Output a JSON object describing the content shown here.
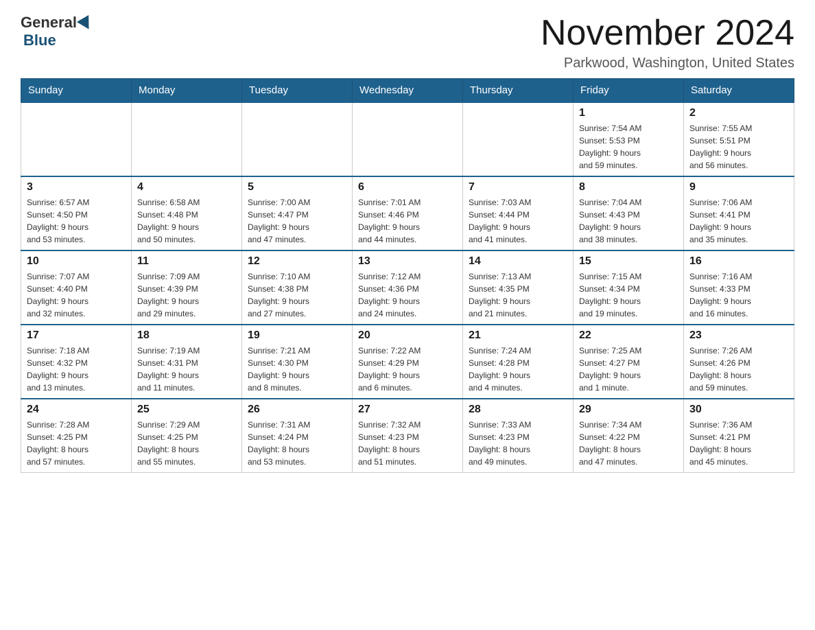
{
  "header": {
    "logo_general": "General",
    "logo_blue": "Blue",
    "month_title": "November 2024",
    "location": "Parkwood, Washington, United States"
  },
  "days_of_week": [
    "Sunday",
    "Monday",
    "Tuesday",
    "Wednesday",
    "Thursday",
    "Friday",
    "Saturday"
  ],
  "weeks": [
    {
      "days": [
        {
          "number": "",
          "info": ""
        },
        {
          "number": "",
          "info": ""
        },
        {
          "number": "",
          "info": ""
        },
        {
          "number": "",
          "info": ""
        },
        {
          "number": "",
          "info": ""
        },
        {
          "number": "1",
          "info": "Sunrise: 7:54 AM\nSunset: 5:53 PM\nDaylight: 9 hours\nand 59 minutes."
        },
        {
          "number": "2",
          "info": "Sunrise: 7:55 AM\nSunset: 5:51 PM\nDaylight: 9 hours\nand 56 minutes."
        }
      ]
    },
    {
      "days": [
        {
          "number": "3",
          "info": "Sunrise: 6:57 AM\nSunset: 4:50 PM\nDaylight: 9 hours\nand 53 minutes."
        },
        {
          "number": "4",
          "info": "Sunrise: 6:58 AM\nSunset: 4:48 PM\nDaylight: 9 hours\nand 50 minutes."
        },
        {
          "number": "5",
          "info": "Sunrise: 7:00 AM\nSunset: 4:47 PM\nDaylight: 9 hours\nand 47 minutes."
        },
        {
          "number": "6",
          "info": "Sunrise: 7:01 AM\nSunset: 4:46 PM\nDaylight: 9 hours\nand 44 minutes."
        },
        {
          "number": "7",
          "info": "Sunrise: 7:03 AM\nSunset: 4:44 PM\nDaylight: 9 hours\nand 41 minutes."
        },
        {
          "number": "8",
          "info": "Sunrise: 7:04 AM\nSunset: 4:43 PM\nDaylight: 9 hours\nand 38 minutes."
        },
        {
          "number": "9",
          "info": "Sunrise: 7:06 AM\nSunset: 4:41 PM\nDaylight: 9 hours\nand 35 minutes."
        }
      ]
    },
    {
      "days": [
        {
          "number": "10",
          "info": "Sunrise: 7:07 AM\nSunset: 4:40 PM\nDaylight: 9 hours\nand 32 minutes."
        },
        {
          "number": "11",
          "info": "Sunrise: 7:09 AM\nSunset: 4:39 PM\nDaylight: 9 hours\nand 29 minutes."
        },
        {
          "number": "12",
          "info": "Sunrise: 7:10 AM\nSunset: 4:38 PM\nDaylight: 9 hours\nand 27 minutes."
        },
        {
          "number": "13",
          "info": "Sunrise: 7:12 AM\nSunset: 4:36 PM\nDaylight: 9 hours\nand 24 minutes."
        },
        {
          "number": "14",
          "info": "Sunrise: 7:13 AM\nSunset: 4:35 PM\nDaylight: 9 hours\nand 21 minutes."
        },
        {
          "number": "15",
          "info": "Sunrise: 7:15 AM\nSunset: 4:34 PM\nDaylight: 9 hours\nand 19 minutes."
        },
        {
          "number": "16",
          "info": "Sunrise: 7:16 AM\nSunset: 4:33 PM\nDaylight: 9 hours\nand 16 minutes."
        }
      ]
    },
    {
      "days": [
        {
          "number": "17",
          "info": "Sunrise: 7:18 AM\nSunset: 4:32 PM\nDaylight: 9 hours\nand 13 minutes."
        },
        {
          "number": "18",
          "info": "Sunrise: 7:19 AM\nSunset: 4:31 PM\nDaylight: 9 hours\nand 11 minutes."
        },
        {
          "number": "19",
          "info": "Sunrise: 7:21 AM\nSunset: 4:30 PM\nDaylight: 9 hours\nand 8 minutes."
        },
        {
          "number": "20",
          "info": "Sunrise: 7:22 AM\nSunset: 4:29 PM\nDaylight: 9 hours\nand 6 minutes."
        },
        {
          "number": "21",
          "info": "Sunrise: 7:24 AM\nSunset: 4:28 PM\nDaylight: 9 hours\nand 4 minutes."
        },
        {
          "number": "22",
          "info": "Sunrise: 7:25 AM\nSunset: 4:27 PM\nDaylight: 9 hours\nand 1 minute."
        },
        {
          "number": "23",
          "info": "Sunrise: 7:26 AM\nSunset: 4:26 PM\nDaylight: 8 hours\nand 59 minutes."
        }
      ]
    },
    {
      "days": [
        {
          "number": "24",
          "info": "Sunrise: 7:28 AM\nSunset: 4:25 PM\nDaylight: 8 hours\nand 57 minutes."
        },
        {
          "number": "25",
          "info": "Sunrise: 7:29 AM\nSunset: 4:25 PM\nDaylight: 8 hours\nand 55 minutes."
        },
        {
          "number": "26",
          "info": "Sunrise: 7:31 AM\nSunset: 4:24 PM\nDaylight: 8 hours\nand 53 minutes."
        },
        {
          "number": "27",
          "info": "Sunrise: 7:32 AM\nSunset: 4:23 PM\nDaylight: 8 hours\nand 51 minutes."
        },
        {
          "number": "28",
          "info": "Sunrise: 7:33 AM\nSunset: 4:23 PM\nDaylight: 8 hours\nand 49 minutes."
        },
        {
          "number": "29",
          "info": "Sunrise: 7:34 AM\nSunset: 4:22 PM\nDaylight: 8 hours\nand 47 minutes."
        },
        {
          "number": "30",
          "info": "Sunrise: 7:36 AM\nSunset: 4:21 PM\nDaylight: 8 hours\nand 45 minutes."
        }
      ]
    }
  ]
}
